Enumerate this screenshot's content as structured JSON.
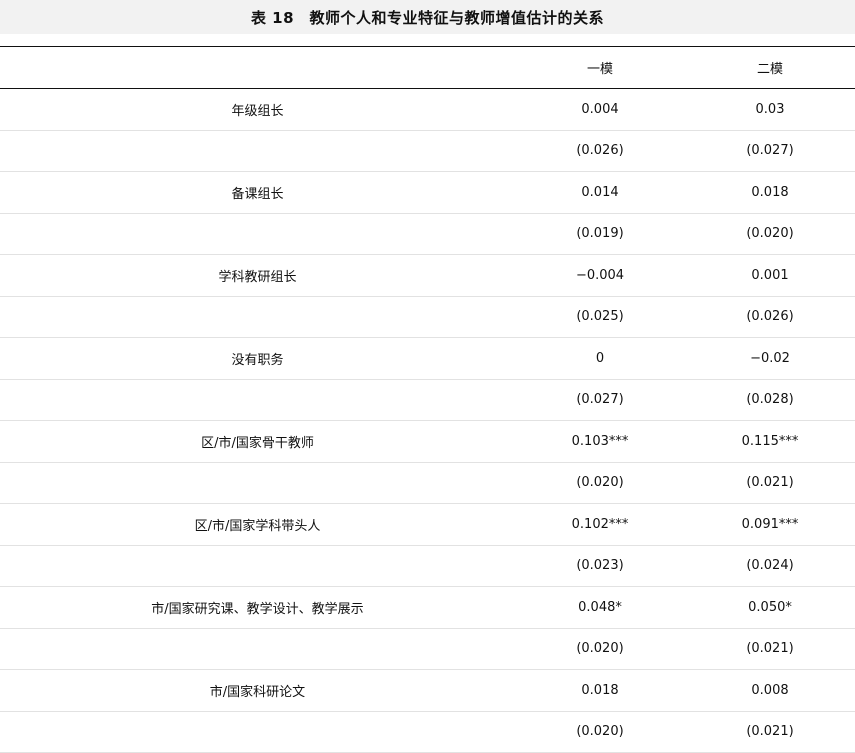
{
  "title": "表 18　教师个人和专业特征与教师增值估计的关系",
  "header": {
    "col_label": "",
    "col_model1": "一模",
    "col_model2": "二模"
  },
  "rows": [
    {
      "label": "年级组长",
      "m1": "0.004",
      "m2": "0.03"
    },
    {
      "label": "",
      "m1": "(0.026)",
      "m2": "(0.027)"
    },
    {
      "label": "备课组长",
      "m1": "0.014",
      "m2": "0.018"
    },
    {
      "label": "",
      "m1": "(0.019)",
      "m2": "(0.020)"
    },
    {
      "label": "学科教研组长",
      "m1": "−0.004",
      "m2": "0.001"
    },
    {
      "label": "",
      "m1": "(0.025)",
      "m2": "(0.026)"
    },
    {
      "label": "没有职务",
      "m1": "0",
      "m2": "−0.02"
    },
    {
      "label": "",
      "m1": "(0.027)",
      "m2": "(0.028)"
    },
    {
      "label": "区/市/国家骨干教师",
      "m1": "0.103***",
      "m2": "0.115***"
    },
    {
      "label": "",
      "m1": "(0.020)",
      "m2": "(0.021)"
    },
    {
      "label": "区/市/国家学科带头人",
      "m1": "0.102***",
      "m2": "0.091***"
    },
    {
      "label": "",
      "m1": "(0.023)",
      "m2": "(0.024)"
    },
    {
      "label": "市/国家研究课、教学设计、教学展示",
      "m1": "0.048*",
      "m2": "0.050*"
    },
    {
      "label": "",
      "m1": "(0.020)",
      "m2": "(0.021)"
    },
    {
      "label": "市/国家科研论文",
      "m1": "0.018",
      "m2": "0.008"
    },
    {
      "label": "",
      "m1": "(0.020)",
      "m2": "(0.021)"
    }
  ]
}
